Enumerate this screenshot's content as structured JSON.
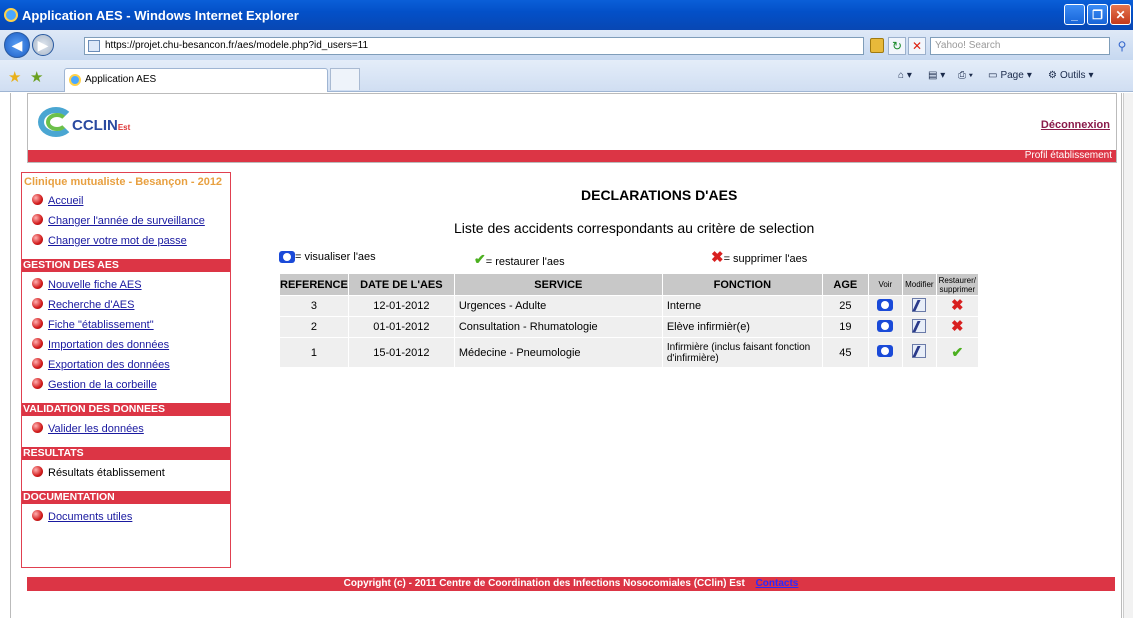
{
  "window": {
    "title": "Application AES - Windows Internet Explorer",
    "url": "https://projet.chu-besancon.fr/aes/modele.php?id_users=11",
    "search_placeholder": "Yahoo! Search",
    "tab_label": "Application AES",
    "page_menu": "Page",
    "tools_menu": "Outils"
  },
  "header": {
    "logo_text": "CCLIN",
    "logo_sub": "Est",
    "logout": "Déconnexion",
    "profile": "Profil établissement"
  },
  "sidebar": {
    "title": "Clinique mutualiste - Besançon - 2012",
    "top_items": [
      "Accueil",
      "Changer l'année de surveillance",
      "Changer votre mot de passe"
    ],
    "sections": [
      {
        "heading": "GESTION DES AES",
        "items": [
          "Nouvelle fiche AES",
          "Recherche d'AES",
          "Fiche \"établissement\"",
          "Importation des données",
          "Exportation des données",
          "Gestion de la corbeille"
        ]
      },
      {
        "heading": "VALIDATION DES DONNEES",
        "items": [
          "Valider les données"
        ]
      },
      {
        "heading": "RESULTATS",
        "items": [
          "Résultats établissement"
        ]
      },
      {
        "heading": "DOCUMENTATION",
        "items": [
          "Documents utiles"
        ]
      }
    ]
  },
  "main": {
    "title": "DECLARATIONS D'AES",
    "subtitle": "Liste des accidents correspondants au critère de selection",
    "legend": {
      "view": "= visualiser l'aes",
      "restore": "= restaurer l'aes",
      "delete": "= supprimer l'aes"
    },
    "table": {
      "headers": [
        "REFERENCE",
        "DATE DE L'AES",
        "SERVICE",
        "FONCTION",
        "AGE",
        "Voir",
        "Modifier",
        "Restaurer/ supprimer"
      ],
      "rows": [
        {
          "ref": "3",
          "date": "12-01-2012",
          "service": "Urgences - Adulte",
          "fonction": "Interne",
          "age": "25",
          "action": "delete"
        },
        {
          "ref": "2",
          "date": "01-01-2012",
          "service": "Consultation - Rhumatologie",
          "fonction": "Elève infirmièr(e)",
          "age": "19",
          "action": "delete"
        },
        {
          "ref": "1",
          "date": "15-01-2012",
          "service": "Médecine - Pneumologie",
          "fonction": "Infirmière (inclus faisant fonction d'infirmière)",
          "age": "45",
          "action": "restore"
        }
      ]
    }
  },
  "footer": {
    "copyright": "Copyright (c) - 2011 Centre de Coordination des Infections Nosocomiales (CClin) Est",
    "contacts": "Contacts"
  }
}
